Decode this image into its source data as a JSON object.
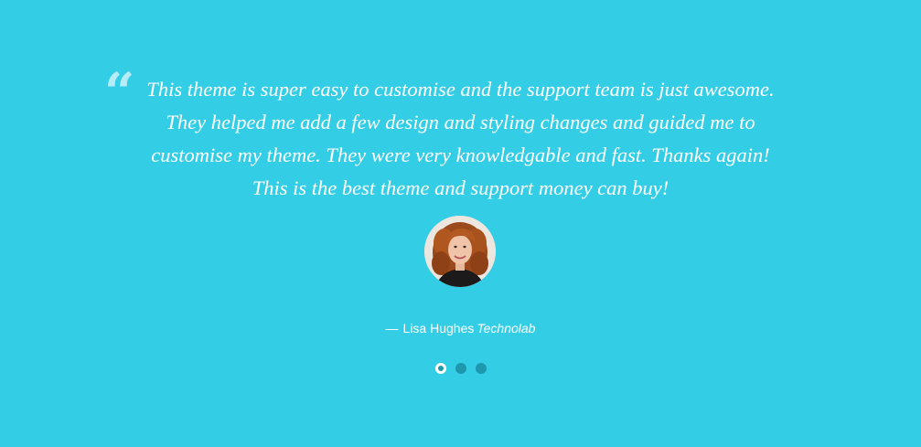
{
  "colors": {
    "background": "#33cde6",
    "quote_mark": "#b5ecf5",
    "text": "#ffffff",
    "dot": "#1e98ad",
    "dot_active_ring": "#ffffff"
  },
  "testimonial": {
    "quote_icon": "quote-open-icon",
    "quote_mark": "“",
    "text": "This theme is super easy to customise and the support team is just awesome. They helped me add a few design and styling changes and guided me to customise my theme. They were very knowledgable and fast. Thanks again! This is the best theme and support money can buy!",
    "author_dash": "—",
    "author_name": "Lisa Hughes",
    "author_company": "Technolab"
  },
  "pagination": {
    "count": 3,
    "active_index": 0
  }
}
